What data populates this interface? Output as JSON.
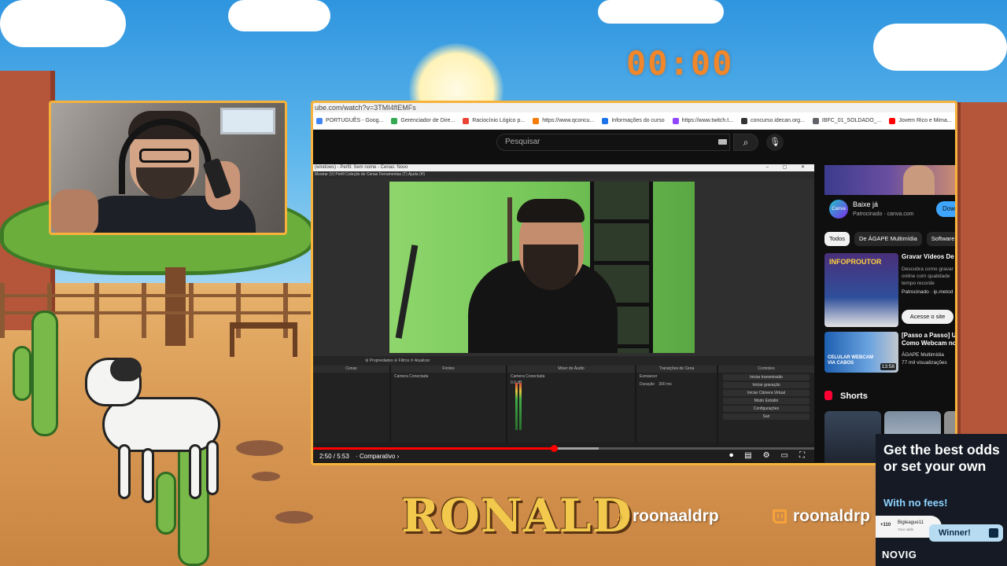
{
  "timer": "00:00",
  "browser": {
    "url": "ube.com/watch?v=3TMI4flEMFs",
    "bookmarks": [
      {
        "label": "PORTUGUÊS - Goog...",
        "color": "#4285f4"
      },
      {
        "label": "Gerenciador de Dire...",
        "color": "#34a853"
      },
      {
        "label": "Raciocínio Lógico p...",
        "color": "#ea4335"
      },
      {
        "label": "https://www.qconcu...",
        "color": "#f57c00"
      },
      {
        "label": "Informações do curso",
        "color": "#1a73e8"
      },
      {
        "label": "https://www.twitch.t...",
        "color": "#9146ff"
      },
      {
        "label": "concurso.idecan.org...",
        "color": "#333333"
      },
      {
        "label": "IBFC_01_SOLDADO_...",
        "color": "#5f6368"
      },
      {
        "label": "Jovem Rico e Mima...",
        "color": "#ff0000"
      }
    ],
    "search_placeholder": "Pesquisar"
  },
  "player": {
    "obs_title": "(windows) - Perfil: Sem nome - Cenas: Novo",
    "obs_menu": "Mostrar (V)   Perfil   Coleção de Cenas   Ferramentas (T)   Ajuda (H)",
    "docks_bar": "⚙ Propriedades   ⊘ Filtros   ⟳ Atualizar",
    "docks": {
      "scenes": "Cenas",
      "sources": "Fontes",
      "source_item": "Camera Conectada",
      "mixer": "Mixer de Áudio",
      "mixer_item": "Camera Conectada",
      "mixer_db": "0.0 dB",
      "transitions": "Transições de Cena",
      "transition_value": "Esmaecer",
      "duration_label": "Duração",
      "duration_value": "300 ms",
      "controls": "Controles",
      "control_buttons": [
        "Iniciar transmissão",
        "Iniciar gravação",
        "Iniciar Câmera Virtual",
        "Modo Estúdio",
        "Configurações",
        "Sair"
      ]
    },
    "current_time": "2:50",
    "duration": "5:53",
    "chapter": "Comparativo",
    "progress_fraction": 0.48,
    "buffer_fraction": 0.57
  },
  "sidebar": {
    "ad_title": "Baixe já",
    "ad_sponsor": "Patrocinado",
    "ad_domain": "canva.com",
    "ad_button": "Down",
    "chips": [
      "Todos",
      "De ÁGAPE Multimídia",
      "Software"
    ],
    "rec1": {
      "thumb_text": "INFOPROUTOR",
      "title": "Gravar Vídeos De Q",
      "desc": "Descubra como gravar online com qualidade tempo recorde",
      "sponsor": "Patrocinado · ip.metod",
      "button": "Acesse o site"
    },
    "rec2": {
      "thumb_text": "CELULAR WEBCAM VIA CABOS",
      "duration": "13:58",
      "title": "[Passo a Passo] Use",
      "title2": "Como Webcam no P",
      "channel": "ÁGAPE Multimídia",
      "views": "77 mil visualizações"
    },
    "shorts_label": "Shorts"
  },
  "overlay": {
    "name": "RONALD",
    "tiktok": "roonaaldrp",
    "twitch": "roonaldrp"
  },
  "novig": {
    "headline": "Get the best odds or set your own",
    "sub": "With no fees!",
    "odds": "+110",
    "user": "Bigleague11",
    "user_line": "Your odds",
    "winner": "Winner!",
    "brand": "NOVIG"
  }
}
